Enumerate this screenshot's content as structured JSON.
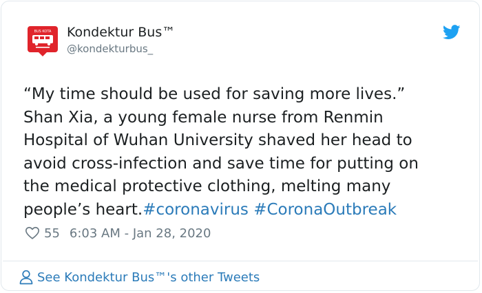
{
  "author": {
    "name": "Kondektur Bus™",
    "handle": "@kondekturbus_",
    "avatar_text": "BUS KOTA"
  },
  "tweet": {
    "lines": [
      "“My time should be used for saving more lives.”",
      "Shan Xia, a young female nurse from Renmin",
      "Hospital of Wuhan University shaved her head to",
      "avoid cross-infection and save time for putting on",
      "the medical protective clothing, melting many"
    ],
    "last_line_text": "people’s heart.",
    "hashtags": [
      "#coronavirus",
      "#CoronaOutbreak"
    ]
  },
  "meta": {
    "likes": "55",
    "timestamp": "6:03 AM - Jan 28, 2020"
  },
  "footer": {
    "link_text": "See Kondektur Bus™'s other Tweets"
  },
  "colors": {
    "link": "#2b7bb9",
    "twitter_blue": "#1da1f2",
    "secondary_text": "#697882",
    "avatar_red": "#e0242b"
  },
  "icons": [
    "twitter-bird-icon",
    "heart-icon",
    "person-icon"
  ]
}
